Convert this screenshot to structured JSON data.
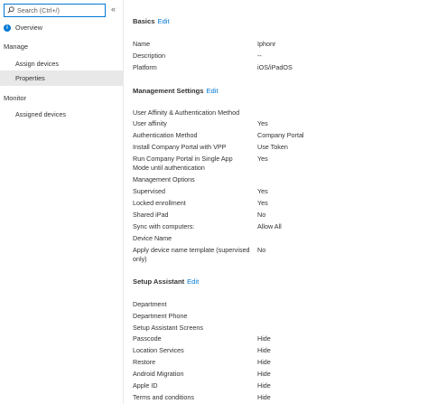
{
  "sidebar": {
    "search_placeholder": "Search (Ctrl+/)",
    "collapse_glyph": "«",
    "overview": "Overview",
    "manage_heading": "Manage",
    "assign_devices": "Assign devices",
    "properties": "Properties",
    "monitor_heading": "Monitor",
    "assigned_devices": "Assigned devices"
  },
  "basics": {
    "title": "Basics",
    "edit": "Edit",
    "rows": [
      {
        "k": "Name",
        "v": "Iphonr"
      },
      {
        "k": "Description",
        "v": "--"
      },
      {
        "k": "Platform",
        "v": "iOS/iPadOS"
      }
    ]
  },
  "management": {
    "title": "Management Settings",
    "edit": "Edit",
    "ua_heading": "User Affinity & Authentication Method",
    "ua_rows": [
      {
        "k": "User affinity",
        "v": "Yes"
      },
      {
        "k": "Authentication Method",
        "v": "Company Portal"
      },
      {
        "k": "Install Company Portal with VPP",
        "v": "Use Token"
      },
      {
        "k": "Run Company Portal in Single App Mode until authentication",
        "v": "Yes"
      }
    ],
    "mo_heading": "Management Options",
    "mo_rows": [
      {
        "k": "Supervised",
        "v": "Yes"
      },
      {
        "k": "Locked enrollment",
        "v": "Yes"
      },
      {
        "k": "Shared iPad",
        "v": "No"
      },
      {
        "k": "Sync with computers:",
        "v": "Allow All"
      }
    ],
    "dn_heading": "Device Name",
    "dn_rows": [
      {
        "k": "Apply device name template (supervised only)",
        "v": "No"
      }
    ]
  },
  "setup": {
    "title": "Setup Assistant",
    "edit": "Edit",
    "department": "Department",
    "department_phone": "Department Phone",
    "screens_heading": "Setup Assistant Screens",
    "rows": [
      {
        "k": "Passcode",
        "v": "Hide"
      },
      {
        "k": "Location Services",
        "v": "Hide"
      },
      {
        "k": "Restore",
        "v": "Hide"
      },
      {
        "k": "Android Migration",
        "v": "Hide"
      },
      {
        "k": "Apple ID",
        "v": "Hide"
      },
      {
        "k": "Terms and conditions",
        "v": "Hide"
      }
    ]
  },
  "colors": {
    "accent": "#0078d4",
    "selected_bg": "#e8e8e8",
    "text": "#323130"
  }
}
